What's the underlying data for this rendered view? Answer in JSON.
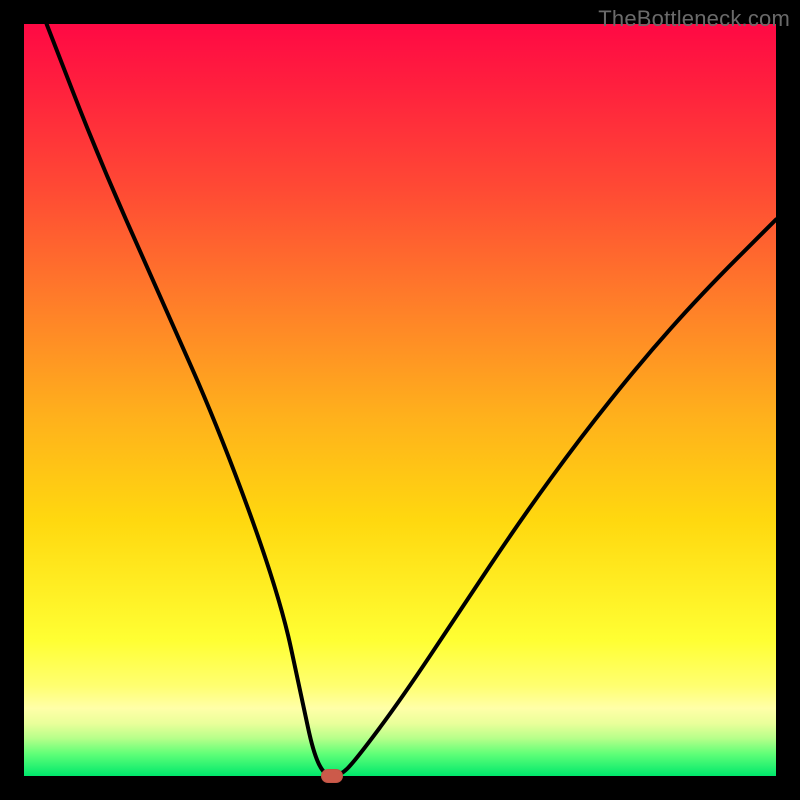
{
  "watermark": "TheBottleneck.com",
  "chart_data": {
    "type": "line",
    "title": "",
    "xlabel": "",
    "ylabel": "",
    "xlim": [
      0,
      100
    ],
    "ylim": [
      0,
      100
    ],
    "series": [
      {
        "name": "curve",
        "x": [
          3,
          10,
          18,
          26,
          34,
          37,
          38.5,
          40,
          42,
          44,
          50,
          58,
          66,
          74,
          82,
          90,
          100
        ],
        "values": [
          100,
          82,
          64,
          46,
          24,
          10,
          3,
          0,
          0,
          2,
          10,
          22,
          34,
          45,
          55,
          64,
          74
        ]
      }
    ],
    "min_marker": {
      "x": 41,
      "y": 0
    },
    "grid": false,
    "legend": false
  },
  "colors": {
    "curve": "#000000",
    "marker": "#cc5a4a",
    "background_top": "#ff0944",
    "background_bottom": "#00e86c",
    "frame": "#000000"
  }
}
